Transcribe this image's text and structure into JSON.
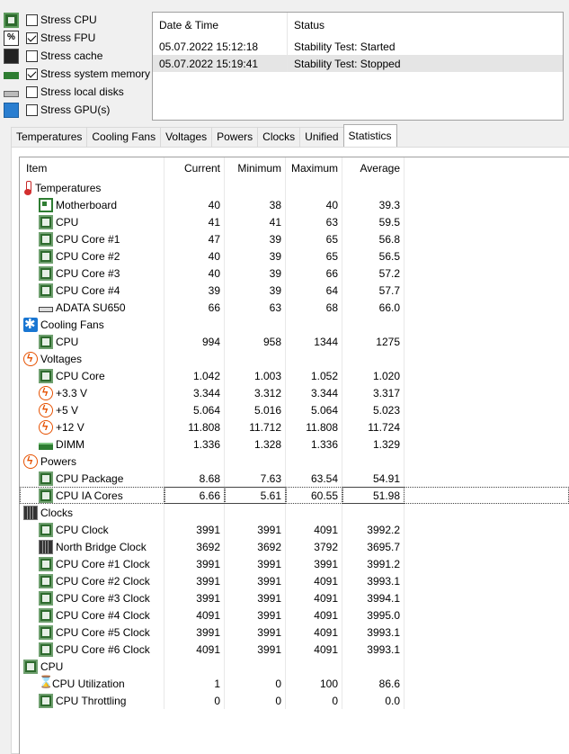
{
  "stress": [
    {
      "label": "Stress CPU",
      "checked": false,
      "icon": "cpu-icon"
    },
    {
      "label": "Stress FPU",
      "checked": true,
      "icon": "fpu-icon"
    },
    {
      "label": "Stress cache",
      "checked": false,
      "icon": "cache-icon"
    },
    {
      "label": "Stress system memory",
      "checked": true,
      "icon": "memory-icon"
    },
    {
      "label": "Stress local disks",
      "checked": false,
      "icon": "disk-icon"
    },
    {
      "label": "Stress GPU(s)",
      "checked": false,
      "icon": "gpu-icon"
    }
  ],
  "fpu_icon_text": "%",
  "log": {
    "headers": [
      "Date & Time",
      "Status"
    ],
    "rows": [
      {
        "time": "05.07.2022 15:12:18",
        "status": "Stability Test: Started"
      },
      {
        "time": "05.07.2022 15:19:41",
        "status": "Stability Test: Stopped"
      }
    ]
  },
  "tabs": [
    "Temperatures",
    "Cooling Fans",
    "Voltages",
    "Powers",
    "Clocks",
    "Unified",
    "Statistics"
  ],
  "active_tab": "Statistics",
  "table": {
    "headers": [
      "Item",
      "Current",
      "Minimum",
      "Maximum",
      "Average"
    ],
    "rows": [
      {
        "type": "group",
        "icon": "thermometer-icon",
        "label": "Temperatures"
      },
      {
        "type": "child",
        "icon": "motherboard-icon",
        "label": "Motherboard",
        "cur": "40",
        "min": "38",
        "max": "40",
        "avg": "39.3"
      },
      {
        "type": "child",
        "icon": "chip-icon",
        "label": "CPU",
        "cur": "41",
        "min": "41",
        "max": "63",
        "avg": "59.5"
      },
      {
        "type": "child",
        "icon": "chip-icon",
        "label": "CPU Core #1",
        "cur": "47",
        "min": "39",
        "max": "65",
        "avg": "56.8"
      },
      {
        "type": "child",
        "icon": "chip-icon",
        "label": "CPU Core #2",
        "cur": "40",
        "min": "39",
        "max": "65",
        "avg": "56.5"
      },
      {
        "type": "child",
        "icon": "chip-icon",
        "label": "CPU Core #3",
        "cur": "40",
        "min": "39",
        "max": "66",
        "avg": "57.2"
      },
      {
        "type": "child",
        "icon": "chip-icon",
        "label": "CPU Core #4",
        "cur": "39",
        "min": "39",
        "max": "64",
        "avg": "57.7"
      },
      {
        "type": "child",
        "icon": "disk-icon",
        "label": "ADATA SU650",
        "cur": "66",
        "min": "63",
        "max": "68",
        "avg": "66.0"
      },
      {
        "type": "group",
        "icon": "fan-icon",
        "label": "Cooling Fans"
      },
      {
        "type": "child",
        "icon": "chip-icon",
        "label": "CPU",
        "cur": "994",
        "min": "958",
        "max": "1344",
        "avg": "1275"
      },
      {
        "type": "group",
        "icon": "bolt-icon",
        "label": "Voltages"
      },
      {
        "type": "child",
        "icon": "chip-icon",
        "label": "CPU Core",
        "cur": "1.042",
        "min": "1.003",
        "max": "1.052",
        "avg": "1.020"
      },
      {
        "type": "child",
        "icon": "bolt-icon",
        "label": "+3.3 V",
        "cur": "3.344",
        "min": "3.312",
        "max": "3.344",
        "avg": "3.317"
      },
      {
        "type": "child",
        "icon": "bolt-icon",
        "label": "+5 V",
        "cur": "5.064",
        "min": "5.016",
        "max": "5.064",
        "avg": "5.023"
      },
      {
        "type": "child",
        "icon": "bolt-icon",
        "label": "+12 V",
        "cur": "11.808",
        "min": "11.712",
        "max": "11.808",
        "avg": "11.724"
      },
      {
        "type": "child",
        "icon": "dimm-icon",
        "label": "DIMM",
        "cur": "1.336",
        "min": "1.328",
        "max": "1.336",
        "avg": "1.329"
      },
      {
        "type": "group",
        "icon": "bolt-icon",
        "label": "Powers"
      },
      {
        "type": "child",
        "icon": "chip-icon",
        "label": "CPU Package",
        "cur": "8.68",
        "min": "7.63",
        "max": "63.54",
        "avg": "54.91"
      },
      {
        "type": "child",
        "icon": "chip-icon",
        "label": "CPU IA Cores",
        "cur": "6.66",
        "min": "5.61",
        "max": "60.55",
        "avg": "51.98",
        "focus": true
      },
      {
        "type": "group",
        "icon": "northbridge-icon",
        "label": "Clocks"
      },
      {
        "type": "child",
        "icon": "chip-icon",
        "label": "CPU Clock",
        "cur": "3991",
        "min": "3991",
        "max": "4091",
        "avg": "3992.2"
      },
      {
        "type": "child",
        "icon": "northbridge-icon",
        "label": "North Bridge Clock",
        "cur": "3692",
        "min": "3692",
        "max": "3792",
        "avg": "3695.7"
      },
      {
        "type": "child",
        "icon": "chip-icon",
        "label": "CPU Core #1 Clock",
        "cur": "3991",
        "min": "3991",
        "max": "3991",
        "avg": "3991.2"
      },
      {
        "type": "child",
        "icon": "chip-icon",
        "label": "CPU Core #2 Clock",
        "cur": "3991",
        "min": "3991",
        "max": "4091",
        "avg": "3993.1"
      },
      {
        "type": "child",
        "icon": "chip-icon",
        "label": "CPU Core #3 Clock",
        "cur": "3991",
        "min": "3991",
        "max": "4091",
        "avg": "3994.1"
      },
      {
        "type": "child",
        "icon": "chip-icon",
        "label": "CPU Core #4 Clock",
        "cur": "4091",
        "min": "3991",
        "max": "4091",
        "avg": "3995.0"
      },
      {
        "type": "child",
        "icon": "chip-icon",
        "label": "CPU Core #5 Clock",
        "cur": "3991",
        "min": "3991",
        "max": "4091",
        "avg": "3993.1"
      },
      {
        "type": "child",
        "icon": "chip-icon",
        "label": "CPU Core #6 Clock",
        "cur": "4091",
        "min": "3991",
        "max": "4091",
        "avg": "3993.1"
      },
      {
        "type": "group",
        "icon": "chip-icon",
        "label": "CPU"
      },
      {
        "type": "child",
        "icon": "hourglass-icon",
        "label": "CPU Utilization",
        "cur": "1",
        "min": "0",
        "max": "100",
        "avg": "86.6"
      },
      {
        "type": "child",
        "icon": "chip-icon",
        "label": "CPU Throttling",
        "cur": "0",
        "min": "0",
        "max": "0",
        "avg": "0.0"
      }
    ]
  }
}
